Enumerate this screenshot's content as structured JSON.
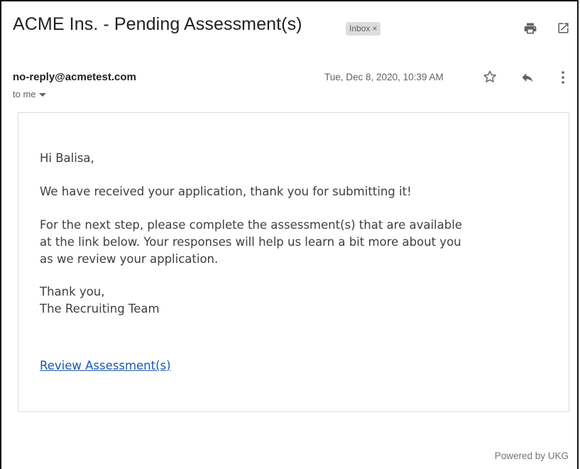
{
  "header": {
    "subject": "ACME Ins. - Pending Assessment(s)",
    "label_chip": "Inbox",
    "label_chip_close": "×"
  },
  "meta": {
    "sender": "no-reply@acmetest.com",
    "recipient": "to me",
    "date": "Tue, Dec 8, 2020, 10:39 AM"
  },
  "icons": {
    "print": "print-icon",
    "open_new_window": "open-in-new-icon",
    "star": "star-icon",
    "reply": "reply-icon",
    "more": "more-vert-icon",
    "recipient_dropdown": "caret-down-icon"
  },
  "message": {
    "greeting": "Hi Balisa,",
    "line1": "We have received your application, thank you for submitting it!",
    "para2_line1": "For the next step, please complete the assessment(s) that are available",
    "para2_line2": "at the link below. Your responses will help us learn a bit more about you",
    "para2_line3": "as we review your application.",
    "signoff": "Thank you,",
    "signature": "The Recruiting Team",
    "link_text": "Review Assessment(s)"
  },
  "footer": {
    "powered_by": "Powered by UKG"
  },
  "colors": {
    "link": "#1a57b6",
    "chip_bg": "#dddddd",
    "muted": "#5f6368"
  }
}
